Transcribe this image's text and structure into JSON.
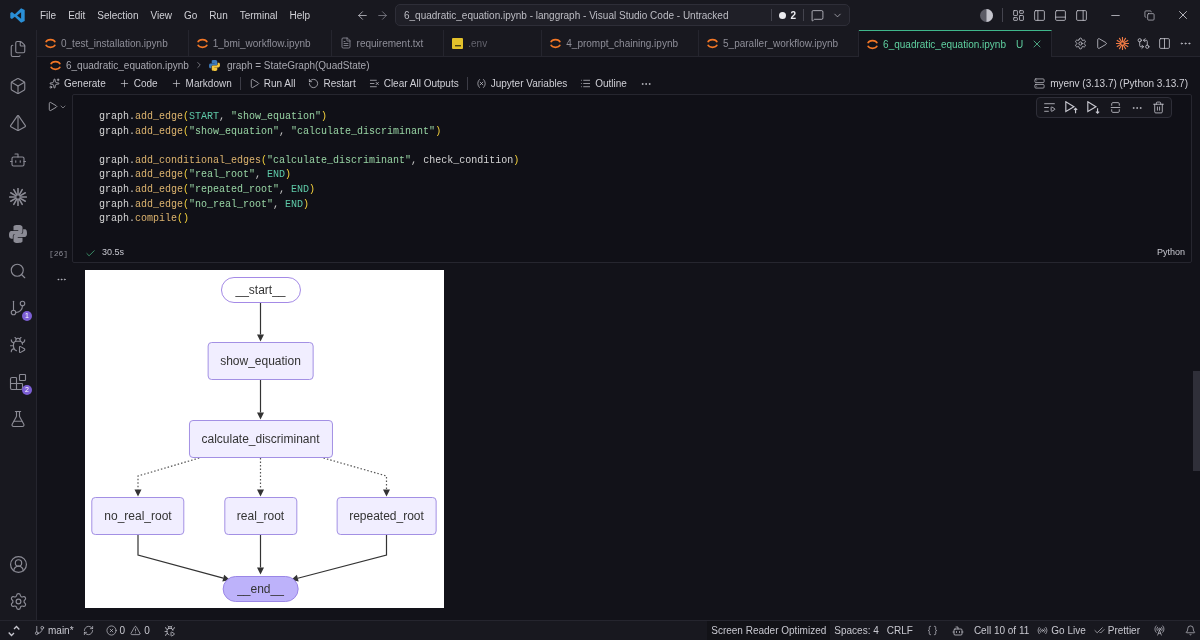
{
  "title_bar": {
    "menus": [
      "File",
      "Edit",
      "Selection",
      "View",
      "Go",
      "Run",
      "Terminal",
      "Help"
    ],
    "command_center": {
      "title": "6_quadratic_equation.ipynb - langgraph - Visual Studio Code - Untracked",
      "count": "2"
    }
  },
  "activity_bar": {
    "source_control_badge": "1",
    "extensions_badge": "2"
  },
  "tabs": [
    {
      "label": "0_test_installation.ipynb",
      "kind": "notebook",
      "selected": false,
      "git_ignored": false
    },
    {
      "label": "1_bmi_workflow.ipynb",
      "kind": "notebook",
      "selected": false,
      "git_ignored": false
    },
    {
      "label": "requirement.txt",
      "kind": "text",
      "selected": false,
      "git_ignored": false
    },
    {
      "label": ".env",
      "kind": "env",
      "selected": false,
      "git_ignored": true
    },
    {
      "label": "4_prompt_chaining.ipynb",
      "kind": "notebook",
      "selected": false,
      "git_ignored": false
    },
    {
      "label": "5_paraller_workflow.ipynb",
      "kind": "notebook",
      "selected": false,
      "git_ignored": false
    },
    {
      "label": "6_quadratic_equation.ipynb",
      "kind": "notebook",
      "selected": true,
      "git_ignored": false,
      "git_status": "U"
    }
  ],
  "breadcrumb": {
    "file": "6_quadratic_equation.ipynb",
    "symbol": "graph = StateGraph(QuadState)"
  },
  "toolbar": {
    "groups": [
      [
        "Generate",
        "Code",
        "Markdown"
      ],
      [
        "Run All",
        "Restart",
        "Clear All Outputs"
      ],
      [
        "Jupyter Variables",
        "Outline"
      ]
    ],
    "kernel": "myenv (3.13.7) (Python 3.13.7)"
  },
  "cell": {
    "execution_count": "[26]",
    "succeeded": true,
    "duration": "30.5s",
    "language": "Python",
    "code_blocks": [
      [
        [
          {
            "text": "graph",
            "kind": "var"
          },
          {
            "text": ".",
            "kind": "punct"
          },
          {
            "text": "add_edge",
            "kind": "func"
          },
          {
            "text": "(",
            "kind": "bracket"
          },
          {
            "text": "START",
            "kind": "const"
          },
          {
            "text": ", ",
            "kind": "punct"
          },
          {
            "text": "\"show_equation\"",
            "kind": "string"
          },
          {
            "text": ")",
            "kind": "bracket"
          }
        ],
        [
          {
            "text": "graph",
            "kind": "var"
          },
          {
            "text": ".",
            "kind": "punct"
          },
          {
            "text": "add_edge",
            "kind": "func"
          },
          {
            "text": "(",
            "kind": "bracket"
          },
          {
            "text": "\"show_equation\"",
            "kind": "string"
          },
          {
            "text": ", ",
            "kind": "punct"
          },
          {
            "text": "\"calculate_discriminant\"",
            "kind": "string"
          },
          {
            "text": ")",
            "kind": "bracket"
          }
        ]
      ],
      [
        [
          {
            "text": "graph",
            "kind": "var"
          },
          {
            "text": ".",
            "kind": "punct"
          },
          {
            "text": "add_conditional_edges",
            "kind": "func"
          },
          {
            "text": "(",
            "kind": "bracket"
          },
          {
            "text": "\"calculate_discriminant\"",
            "kind": "string"
          },
          {
            "text": ", ",
            "kind": "punct"
          },
          {
            "text": "check_condition",
            "kind": "var"
          },
          {
            "text": ")",
            "kind": "bracket"
          }
        ],
        [
          {
            "text": "graph",
            "kind": "var"
          },
          {
            "text": ".",
            "kind": "punct"
          },
          {
            "text": "add_edge",
            "kind": "func"
          },
          {
            "text": "(",
            "kind": "bracket"
          },
          {
            "text": "\"real_root\"",
            "kind": "string"
          },
          {
            "text": ", ",
            "kind": "punct"
          },
          {
            "text": "END",
            "kind": "const"
          },
          {
            "text": ")",
            "kind": "bracket"
          }
        ],
        [
          {
            "text": "graph",
            "kind": "var"
          },
          {
            "text": ".",
            "kind": "punct"
          },
          {
            "text": "add_edge",
            "kind": "func"
          },
          {
            "text": "(",
            "kind": "bracket"
          },
          {
            "text": "\"repeated_root\"",
            "kind": "string"
          },
          {
            "text": ", ",
            "kind": "punct"
          },
          {
            "text": "END",
            "kind": "const"
          },
          {
            "text": ")",
            "kind": "bracket"
          }
        ],
        [
          {
            "text": "graph",
            "kind": "var"
          },
          {
            "text": ".",
            "kind": "punct"
          },
          {
            "text": "add_edge",
            "kind": "func"
          },
          {
            "text": "(",
            "kind": "bracket"
          },
          {
            "text": "\"no_real_root\"",
            "kind": "string"
          },
          {
            "text": ", ",
            "kind": "punct"
          },
          {
            "text": "END",
            "kind": "const"
          },
          {
            "text": ")",
            "kind": "bracket"
          }
        ],
        [
          {
            "text": "graph",
            "kind": "var"
          },
          {
            "text": ".",
            "kind": "punct"
          },
          {
            "text": "compile",
            "kind": "func"
          },
          {
            "text": "()",
            "kind": "bracket"
          }
        ]
      ]
    ]
  },
  "output": {
    "graph": {
      "rows": [
        {
          "nodes": [
            {
              "label": "__start__",
              "kind": "start"
            }
          ],
          "conditional": false
        },
        {
          "nodes": [
            {
              "label": "show_equation",
              "kind": "step"
            }
          ],
          "conditional": false
        },
        {
          "nodes": [
            {
              "label": "calculate_discriminant",
              "kind": "step"
            }
          ],
          "conditional": true
        },
        {
          "nodes": [
            {
              "label": "no_real_root",
              "kind": "step"
            },
            {
              "label": "real_root",
              "kind": "step"
            },
            {
              "label": "repeated_root",
              "kind": "step"
            }
          ],
          "conditional": false
        },
        {
          "nodes": [
            {
              "label": "__end__",
              "kind": "end"
            }
          ]
        }
      ]
    }
  },
  "status_bar": {
    "branch": "main*",
    "errors": "0",
    "warnings": "0",
    "right": [
      "Screen Reader Optimized",
      "Spaces: 4",
      "CRLF",
      "Cell 10 of 11",
      "Go Live",
      "Prettier"
    ]
  }
}
